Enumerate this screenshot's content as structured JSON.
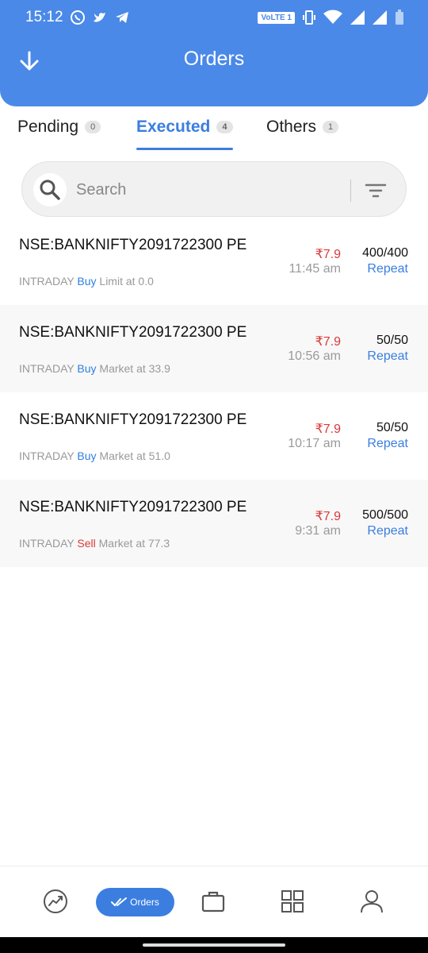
{
  "status": {
    "time": "15:12",
    "volte": "VoLTE 1"
  },
  "header": {
    "title": "Orders"
  },
  "tabs": [
    {
      "label": "Pending",
      "count": "0"
    },
    {
      "label": "Executed",
      "count": "4"
    },
    {
      "label": "Others",
      "count": "1"
    }
  ],
  "search": {
    "placeholder": "Search"
  },
  "orders": [
    {
      "symbol": "NSE:BANKNIFTY2091722300 PE",
      "product": "INTRADAY",
      "side": "Buy",
      "detail": "Limit at 0.0",
      "price": "₹7.9",
      "time": "11:45 am",
      "qty": "400/400",
      "action": "Repeat"
    },
    {
      "symbol": "NSE:BANKNIFTY2091722300 PE",
      "product": "INTRADAY",
      "side": "Buy",
      "detail": "Market at 33.9",
      "price": "₹7.9",
      "time": "10:56 am",
      "qty": "50/50",
      "action": "Repeat"
    },
    {
      "symbol": "NSE:BANKNIFTY2091722300 PE",
      "product": "INTRADAY",
      "side": "Buy",
      "detail": "Market at 51.0",
      "price": "₹7.9",
      "time": "10:17 am",
      "qty": "50/50",
      "action": "Repeat"
    },
    {
      "symbol": "NSE:BANKNIFTY2091722300 PE",
      "product": "INTRADAY",
      "side": "Sell",
      "detail": "Market at 77.3",
      "price": "₹7.9",
      "time": "9:31 am",
      "qty": "500/500",
      "action": "Repeat"
    }
  ],
  "bottomnav": {
    "orders_label": "Orders"
  },
  "colors": {
    "primary": "#4a89e8",
    "accent": "#3b7ee0",
    "sell": "#d93a3a"
  },
  "icons": [
    "back-arrow-icon",
    "search-icon",
    "filter-icon",
    "chart-icon",
    "portfolio-icon",
    "grid-icon",
    "profile-icon"
  ]
}
